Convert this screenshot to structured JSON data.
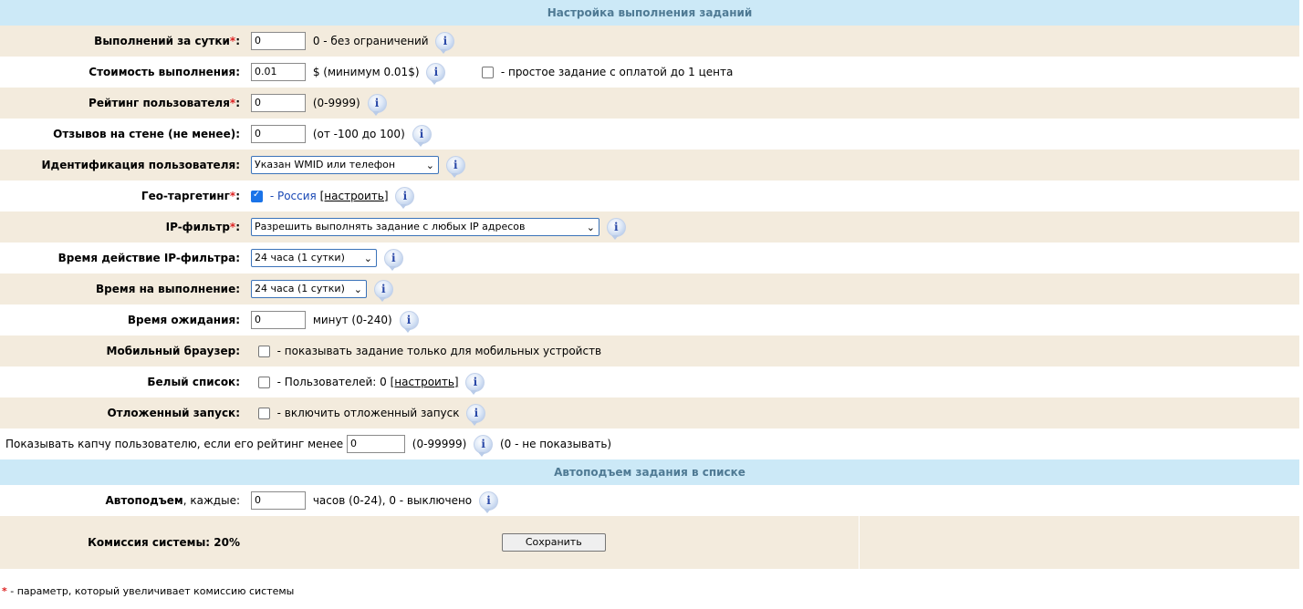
{
  "sections": {
    "execution_title": "Настройка выполнения заданий",
    "autoraise_title": "Автоподъем задания в списке"
  },
  "rows": {
    "per_day": {
      "label": "Выполнений за сутки",
      "value": "0",
      "hint": "0 - без ограничений"
    },
    "cost": {
      "label": "Стоимость выполнения:",
      "value": "0.01",
      "hint": "$ (минимум 0.01$)",
      "checkbox_text": "- простое задание с оплатой до 1 цента"
    },
    "rating": {
      "label": "Рейтинг пользователя",
      "value": "0",
      "hint": "(0-9999)"
    },
    "reviews": {
      "label": "Отзывов на стене (не менее):",
      "value": "0",
      "hint": "(от -100 до 100)"
    },
    "ident": {
      "label": "Идентификация пользователя:",
      "selected": "Указан WMID или телефон"
    },
    "geo": {
      "label": "Гео-таргетинг",
      "country": "- Россия",
      "configure": "[настроить]"
    },
    "ipfilter": {
      "label": "IP-фильтр",
      "selected": "Разрешить выполнять задание с любых IP адресов"
    },
    "ip_time": {
      "label": "Время действие IP-фильтра:",
      "selected": "24 часа (1 сутки)"
    },
    "exec_time": {
      "label": "Время на выполнение:",
      "selected": "24 часа (1 сутки)"
    },
    "wait": {
      "label": "Время ожидания:",
      "value": "0",
      "hint": "минут (0-240)"
    },
    "mobile": {
      "label": "Мобильный браузер:",
      "text": "- показывать задание только для мобильных устройств"
    },
    "whitelist": {
      "label": "Белый список:",
      "text": "- Пользователей: 0",
      "configure": "[настроить]"
    },
    "delayed": {
      "label": "Отложенный запуск:",
      "text": "- включить отложенный запуск"
    },
    "captcha": {
      "text": "Показывать капчу пользователю, если его рейтинг менее",
      "value": "0",
      "range": "(0-99999)",
      "hint": "(0 - не показывать)"
    },
    "autoraise": {
      "label_bold": "Автоподъем",
      "label_rest": ", каждые:",
      "value": "0",
      "hint": "часов (0-24), 0 - выключено"
    },
    "commission": {
      "label": "Комиссия системы: 20%",
      "save": "Сохранить"
    }
  },
  "required_mark": "*",
  "footnote": {
    "mark": "*",
    "text": " - параметр, который увеличивает комиссию системы"
  },
  "colors": {
    "header_bg": "#cce9f7",
    "alt_row_bg": "#f3ebdd",
    "required": "#dd2222"
  }
}
